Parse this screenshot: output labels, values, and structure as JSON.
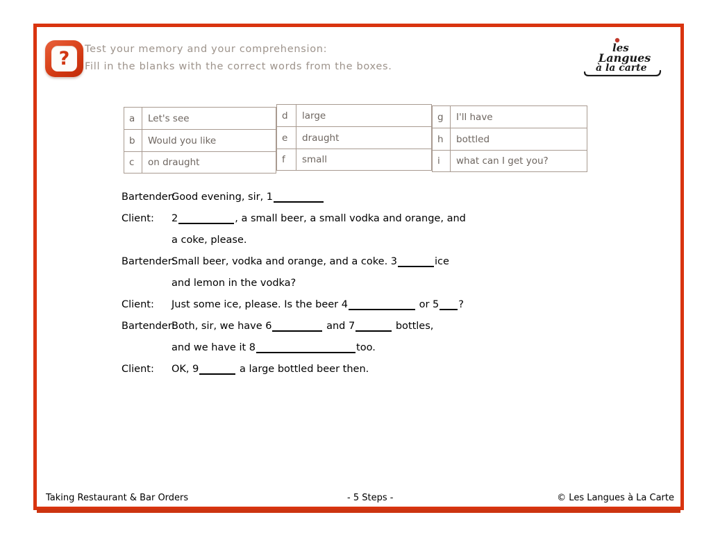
{
  "header": {
    "icon": "question-mark-badge-icon",
    "line1": "Test your memory and your comprehension:",
    "line2": "Fill in the blanks with the correct words from the boxes."
  },
  "logo": {
    "line1": "les",
    "line2": "Langues",
    "line3": "à la carte",
    "accent_color": "#c0392b",
    "text_color": "#1a1a1a"
  },
  "word_bank": {
    "groups": [
      {
        "items": [
          {
            "letter": "a",
            "word": "Let's see"
          },
          {
            "letter": "b",
            "word": "Would you like"
          },
          {
            "letter": "c",
            "word": "on draught"
          }
        ]
      },
      {
        "items": [
          {
            "letter": "d",
            "word": "large"
          },
          {
            "letter": "e",
            "word": "draught"
          },
          {
            "letter": "f",
            "word": "small"
          }
        ]
      },
      {
        "items": [
          {
            "letter": "g",
            "word": "I'll have"
          },
          {
            "letter": "h",
            "word": "bottled"
          },
          {
            "letter": "i",
            "word": "what can I get you?"
          }
        ]
      }
    ]
  },
  "dialogue": {
    "lines": [
      {
        "speaker": "Bartender:",
        "indent": false,
        "parts": [
          {
            "type": "text",
            "value": "Good evening, sir, 1"
          },
          {
            "type": "blank",
            "number": "1",
            "width": "w8"
          }
        ]
      },
      {
        "speaker": "Client:",
        "indent": false,
        "parts": [
          {
            "type": "text",
            "value": "2"
          },
          {
            "type": "blank",
            "number": "2",
            "width": "w9"
          },
          {
            "type": "text",
            "value": ", a small beer, a small vodka and orange, and"
          }
        ]
      },
      {
        "speaker": "",
        "indent": true,
        "parts": [
          {
            "type": "text",
            "value": "a coke, please."
          }
        ]
      },
      {
        "speaker": "Bartender:",
        "indent": false,
        "parts": [
          {
            "type": "text",
            "value": "Small beer, vodka and orange, and a coke. 3"
          },
          {
            "type": "blank",
            "number": "3",
            "width": "w6"
          },
          {
            "type": "text",
            "value": "ice"
          }
        ]
      },
      {
        "speaker": "",
        "indent": true,
        "parts": [
          {
            "type": "text",
            "value": "and lemon in the vodka?"
          }
        ]
      },
      {
        "speaker": "Client:",
        "indent": false,
        "parts": [
          {
            "type": "text",
            "value": "Just some ice, please. Is the beer 4"
          },
          {
            "type": "blank",
            "number": "4",
            "width": "w11"
          },
          {
            "type": "text",
            "value": " or 5"
          },
          {
            "type": "blank",
            "number": "5",
            "width": "w3"
          },
          {
            "type": "text",
            "value": "?"
          }
        ]
      },
      {
        "speaker": "Bartender:",
        "indent": false,
        "parts": [
          {
            "type": "text",
            "value": "Both, sir, we have 6"
          },
          {
            "type": "blank",
            "number": "6",
            "width": "w8"
          },
          {
            "type": "text",
            "value": " and 7"
          },
          {
            "type": "blank",
            "number": "7",
            "width": "w6"
          },
          {
            "type": "text",
            "value": " bottles,"
          }
        ]
      },
      {
        "speaker": "",
        "indent": true,
        "parts": [
          {
            "type": "text",
            "value": "and we have it 8"
          },
          {
            "type": "blank",
            "number": "8",
            "width": "w17"
          },
          {
            "type": "text",
            "value": "too."
          }
        ]
      },
      {
        "speaker": "Client:",
        "indent": false,
        "parts": [
          {
            "type": "text",
            "value": "OK, 9"
          },
          {
            "type": "blank",
            "number": "9",
            "width": "w6"
          },
          {
            "type": "text",
            "value": " a large bottled beer then."
          }
        ]
      }
    ]
  },
  "footer": {
    "left": "Taking Restaurant & Bar Orders",
    "center": "- 5 Steps -",
    "right": "© Les Langues à La Carte"
  },
  "colors": {
    "frame_red": "#d9340f",
    "footer_rule_red": "#cc3410",
    "header_text_gray": "#9d938b",
    "table_border": "#a89a90",
    "table_text": "#6e6660",
    "body_text": "#000000"
  }
}
